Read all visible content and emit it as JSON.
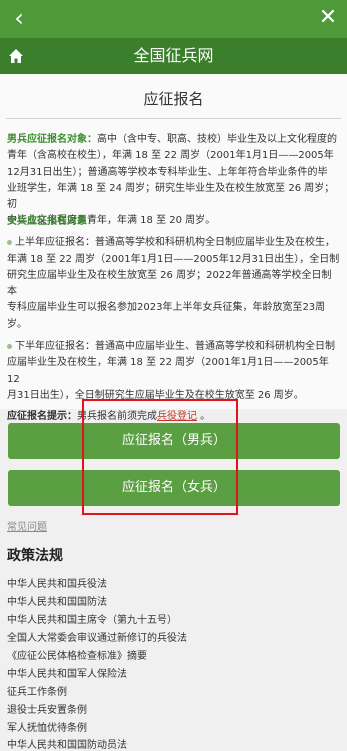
{
  "browser": {
    "back_icon": "chevron-left-icon",
    "close_icon": "close-icon"
  },
  "header": {
    "home_icon": "home-icon",
    "title": "全国征兵网"
  },
  "page": {
    "title": "应征报名"
  },
  "male": {
    "label": "男兵应征报名对象：",
    "lines": [
      "高中（含中专、职高、技校）毕业生及以上文化程度的",
      "青年（含高校在校生），年满 18 至 22 周岁（2001年1月1日——2005年",
      "12月31日出生）；普通高等学校本专科毕业生、上年年符合毕业条件的毕",
      "业班学生，年满 18 至 24 周岁；研究生毕业生及在校生放宽至 26 周岁；初",
      "中毕业文化程度男青年，年满 18 至 20 周岁。"
    ]
  },
  "female": {
    "label": "女兵应征报名对象：",
    "first_half": [
      "上半年应征报名：普通高等学校和科研机构全日制应届毕业生及在校生，",
      "年满 18 至 22 周岁（2001年1月1日——2005年12月31日出生），全日制",
      "研究生应届毕业生及在校生放宽至 26 周岁；2022年普通高等学校全日制本",
      "专科应届毕业生可以报名参加2023年上半年女兵征集，年龄放宽至23周",
      "岁。"
    ],
    "second_half": [
      "下半年应征报名：普通高中应届毕业生、普通高等学校和科研机构全日制",
      "应届毕业生及在校生，年满 18 至 22 周岁（2001年1月1日——2005年12",
      "月31日出生），全日制研究生应届毕业生及在校生放宽至 26 周岁。"
    ]
  },
  "tip": {
    "label": "应征报名提示：",
    "text": "男兵报名前须完成",
    "link": "兵役登记",
    "end": " 。"
  },
  "buttons": {
    "male": "应征报名（男兵）",
    "female": "应征报名（女兵）"
  },
  "faq": "常见问题",
  "policy": {
    "title": "政策法规",
    "items": [
      "中华人民共和国兵役法",
      "中华人民共和国国防法",
      "中华人民共和国主席令（第九十五号）",
      "全国人大常委会审议通过新修订的兵役法",
      "《应征公民体格检查标准》摘要",
      "中华人民共和国军人保险法",
      "征兵工作条例",
      "退役士兵安置条例",
      "军人抚恤优待条例",
      "中华人民共和国国防动员法"
    ]
  },
  "colors": {
    "topbar": "#4f9a38",
    "header": "#3b7e2b",
    "button": "#5aa043",
    "highlight_box": "#e0141b",
    "label_green": "#3b8e2d"
  }
}
